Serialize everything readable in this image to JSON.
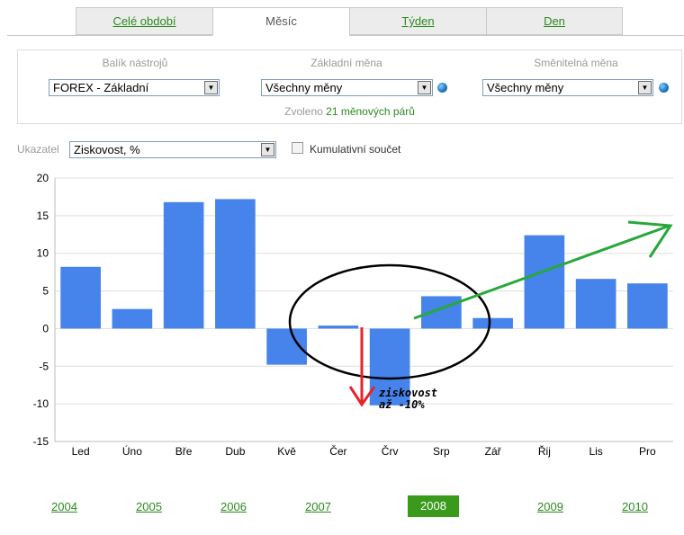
{
  "tabs": [
    {
      "label": "Celé období",
      "active": false
    },
    {
      "label": "Měsíc",
      "active": true
    },
    {
      "label": "Týden",
      "active": false
    },
    {
      "label": "Den",
      "active": false
    }
  ],
  "filters": {
    "toolkit": {
      "label": "Balík nástrojů",
      "value": "FOREX - Základní"
    },
    "base_currency": {
      "label": "Základní měna",
      "value": "Všechny měny"
    },
    "quote_currency": {
      "label": "Směnitelná měna",
      "value": "Všechny měny"
    },
    "selected_pairs": {
      "prefix": "Zvoleno",
      "count": "21 měnových párů"
    }
  },
  "indicator": {
    "label": "Ukazatel",
    "value": "Ziskovost, %",
    "cumulative_label": "Kumulativní součet",
    "cumulative_checked": false
  },
  "chart_data": {
    "type": "bar",
    "categories": [
      "Led",
      "Úno",
      "Bře",
      "Dub",
      "Kvě",
      "Čer",
      "Črv",
      "Srp",
      "Zář",
      "Řij",
      "Lis",
      "Pro"
    ],
    "values": [
      8.2,
      2.6,
      16.8,
      17.2,
      -4.8,
      0.4,
      -10.2,
      4.3,
      1.4,
      12.4,
      6.6,
      6.0
    ],
    "ylim": [
      -15,
      20
    ],
    "yticks": [
      -15,
      -10,
      -5,
      0,
      5,
      10,
      15,
      20
    ],
    "grid": true,
    "bar_color": "#4683ea",
    "annotation": "ziskovost\naž -10%"
  },
  "years": [
    {
      "label": "2004",
      "active": false
    },
    {
      "label": "2005",
      "active": false
    },
    {
      "label": "2006",
      "active": false
    },
    {
      "label": "2007",
      "active": false
    },
    {
      "label": "2008",
      "active": true
    },
    {
      "label": "2009",
      "active": false
    },
    {
      "label": "2010",
      "active": false
    }
  ]
}
